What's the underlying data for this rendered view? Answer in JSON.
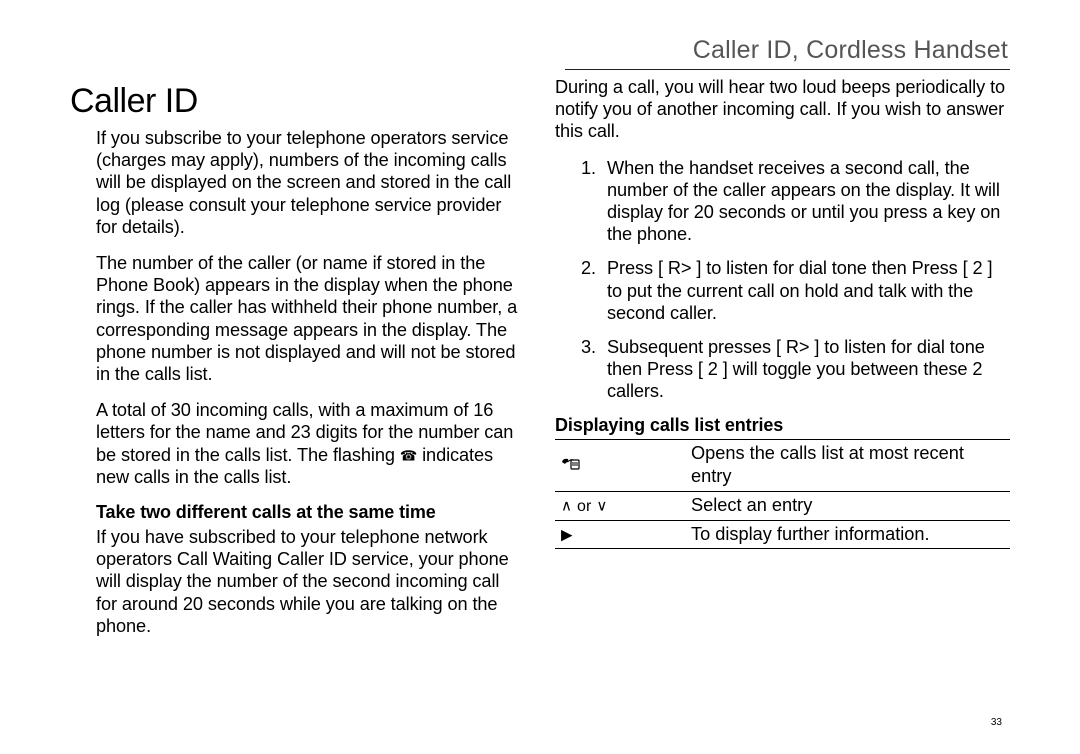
{
  "header": "Caller ID, Cordless Handset",
  "section_title": "Caller ID",
  "left": {
    "p1": "If you subscribe to your telephone operators service (charges may apply), numbers of the incoming calls will be displayed on the screen and stored in the call log (please consult your telephone service provider for details).",
    "p2": "The number of the caller (or name if stored in the Phone Book) appears in the display when the phone rings. If the caller has withheld their phone number, a corresponding message appears in the display. The phone number is not displayed and will not be stored in the calls list.",
    "p3a": "A total of 30 incoming calls, with a maximum of 16 letters for the name and 23 digits for the number can be stored in the calls list. The flashing ",
    "p3b": " indicates new calls in the calls list.",
    "sub1": "Take two different calls at the same time",
    "p4": "If you have subscribed to your telephone network operators Call Waiting Caller ID service, your phone will display the number of the second incoming call for around 20 seconds while you are talking on the phone."
  },
  "right": {
    "p1": "During a call, you will hear two loud beeps periodically to notify you of another incoming call. If you wish to answer this call.",
    "steps": [
      "When the handset receives a second call, the number of the caller appears on the display. It will display for 20 seconds or until you press a key on the phone.",
      "Press [ R> ] to listen for dial tone then Press [ 2 ] to put the current call on hold and talk with the second caller.",
      "Subsequent presses [ R> ] to listen for dial tone then Press [ 2 ] will toggle you between these 2 callers."
    ],
    "sub1": "Displaying calls list entries",
    "table": [
      {
        "key_icon": "handset",
        "desc": "Opens the calls list at most recent entry"
      },
      {
        "key_icon": "updown",
        "key_text": "or",
        "desc": "Select an entry"
      },
      {
        "key_icon": "right",
        "desc": "To display further information."
      }
    ]
  },
  "page_number": "33"
}
